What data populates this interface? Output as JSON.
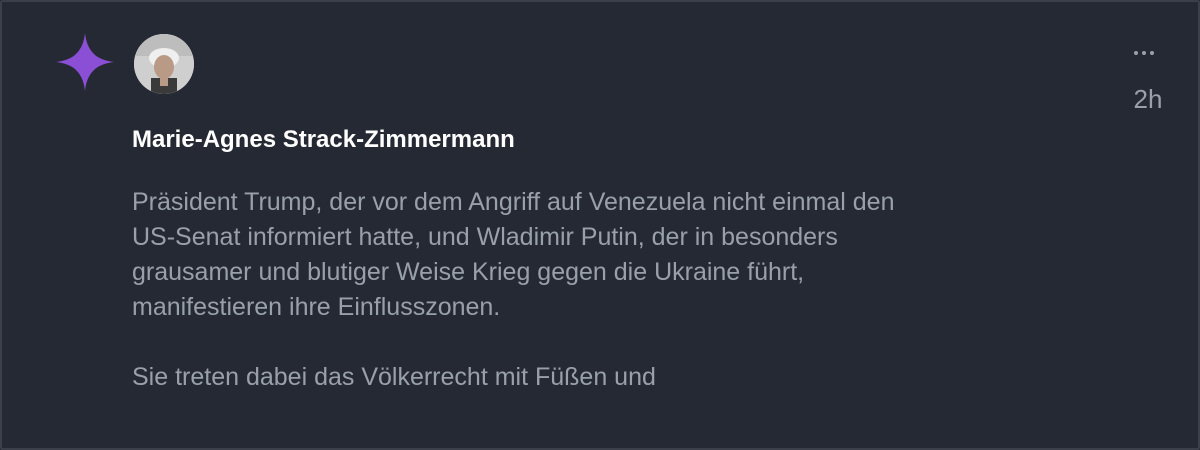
{
  "post": {
    "author_name": "Marie-Agnes Strack-Zimmermann",
    "time_ago": "2h",
    "body_lines": [
      "Präsident Trump, der vor dem Angriff auf Venezuela nicht einmal den",
      "US-Senat informiert hatte, und Wladimir Putin, der in besonders",
      "grausamer und blutiger Weise Krieg gegen die Ukraine führt,",
      "manifestieren ihre Einflusszonen."
    ],
    "body_line_second_para": "Sie treten dabei das Völkerrecht mit Füßen und",
    "icons": {
      "ai_badge": "sparkle-icon",
      "menu": "more-options-icon"
    },
    "colors": {
      "background": "#252933",
      "author": "#ffffff",
      "body_text": "#9aa0aa",
      "sparkle": "#8a4fd4"
    }
  }
}
